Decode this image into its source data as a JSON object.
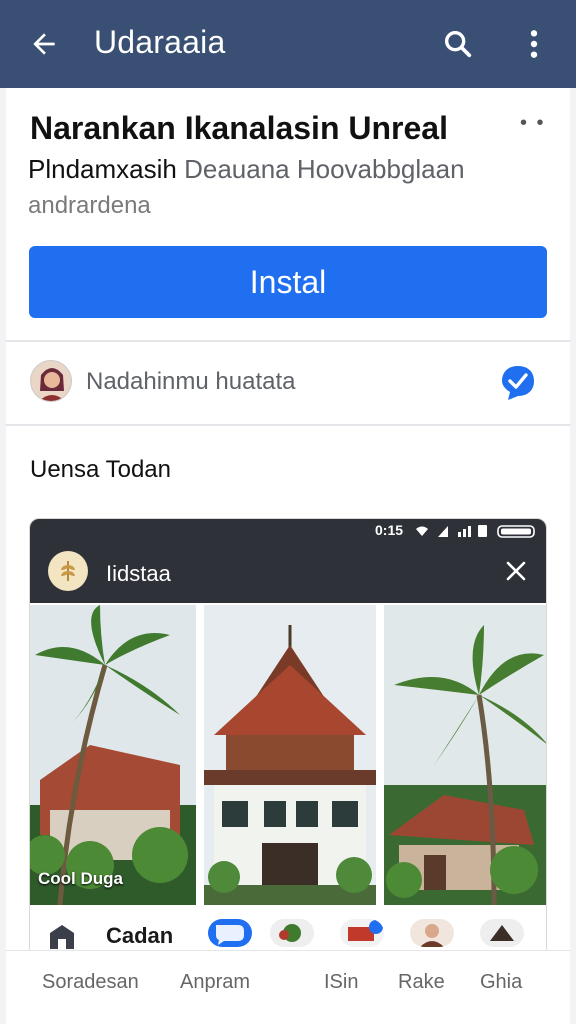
{
  "appbar": {
    "title": "Udaraaia",
    "icons": [
      "back-arrow-icon",
      "search-icon",
      "more-vert-icon"
    ],
    "color": "#3a4f74"
  },
  "app": {
    "name": "Narankan Ikanalasin Unreal",
    "developer": "Plndamxasih",
    "category": "Deauana Hoovabbglaan",
    "subtitle": "andrardena",
    "install_label": "Instal",
    "install_color": "#1f6ff0"
  },
  "review": {
    "reviewer": "Nadahinmu huatata",
    "verified_icon": "verified-check-icon"
  },
  "section": {
    "title": "Uensa Todan"
  },
  "preview": {
    "status_time": "0:15",
    "title": "Iidstaa",
    "photo_caption": "Cool Duga",
    "bottom_name": "Cadan"
  },
  "tabs": [
    "Soradesan",
    "Anpram",
    "ISin",
    "Rake",
    "Ghia"
  ]
}
